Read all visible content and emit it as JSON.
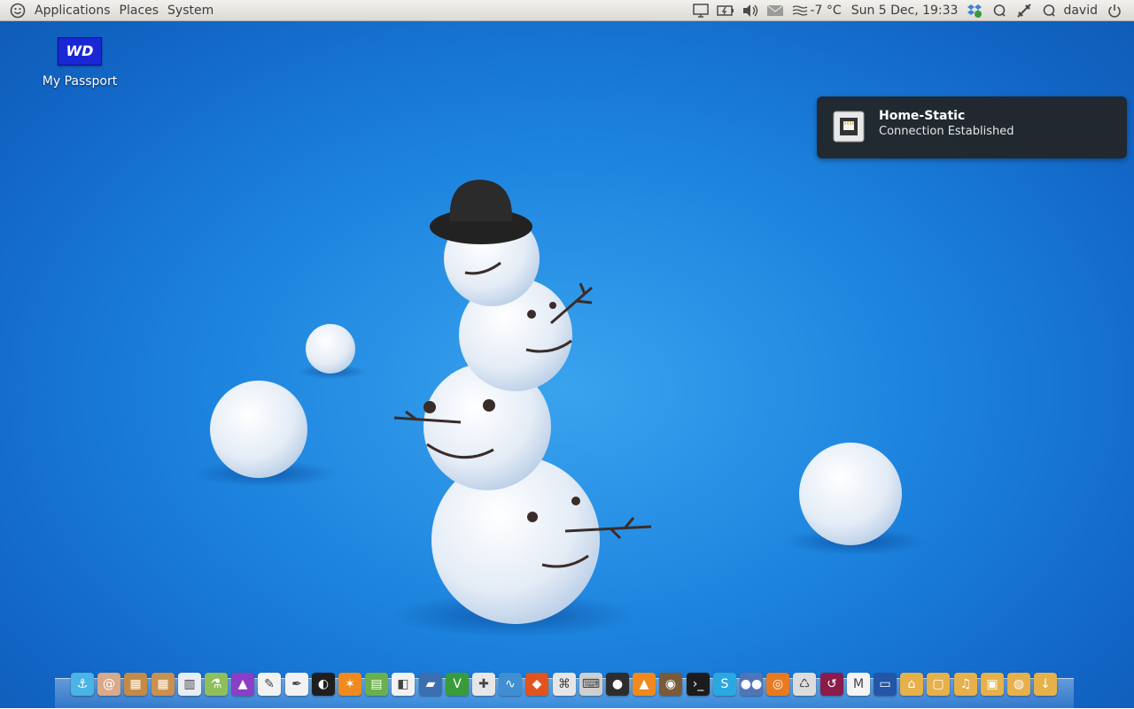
{
  "panel": {
    "menus": [
      "Applications",
      "Places",
      "System"
    ],
    "weather": "-7 °C",
    "clock": "Sun  5 Dec, 19:33",
    "user": "david"
  },
  "desktop": {
    "drive_logo": "WD",
    "drive_label": "My Passport"
  },
  "notification": {
    "title": "Home-Static",
    "body": "Connection Established"
  },
  "dock": {
    "items": [
      {
        "icon": "anchor-icon",
        "color": "#49b4e6",
        "glyph": "⚓"
      },
      {
        "icon": "shell-icon",
        "color": "#d9a98a",
        "glyph": "@"
      },
      {
        "icon": "package-icon",
        "color": "#c48a47",
        "glyph": "▦"
      },
      {
        "icon": "package-installer-icon",
        "color": "#c9904e",
        "glyph": "▦"
      },
      {
        "icon": "system-monitor-icon",
        "color": "#e8ecf5",
        "glyph": "▥"
      },
      {
        "icon": "chemistry-icon",
        "color": "#8fbf5a",
        "glyph": "⚗"
      },
      {
        "icon": "hat-icon",
        "color": "#8b3fc7",
        "glyph": "▲"
      },
      {
        "icon": "vector-draw-icon",
        "color": "#f2f2f2",
        "glyph": "✎"
      },
      {
        "icon": "pen-tool-icon",
        "color": "#f2f2f2",
        "glyph": "✒"
      },
      {
        "icon": "camera-raw-icon",
        "color": "#1e1e1e",
        "glyph": "◐"
      },
      {
        "icon": "figure-icon",
        "color": "#f08a1e",
        "glyph": "✶"
      },
      {
        "icon": "spreadsheet-icon",
        "color": "#6ab04c",
        "glyph": "▤"
      },
      {
        "icon": "presentation-icon",
        "color": "#f2f2f2",
        "glyph": "◧"
      },
      {
        "icon": "chart-app-icon",
        "color": "#3c6fb2",
        "glyph": "▰"
      },
      {
        "icon": "vim-icon",
        "color": "#3a9b3a",
        "glyph": "V"
      },
      {
        "icon": "lifebuoy-icon",
        "color": "#e7e7e7",
        "glyph": "✚"
      },
      {
        "icon": "waveform-icon",
        "color": "#3f8fd2",
        "glyph": "∿"
      },
      {
        "icon": "cube-icon",
        "color": "#e2531e",
        "glyph": "◆"
      },
      {
        "icon": "inkscape-icon",
        "color": "#e6e6e6",
        "glyph": "⌘"
      },
      {
        "icon": "keyboard-icon",
        "color": "#cfcfcf",
        "glyph": "⌨"
      },
      {
        "icon": "webcam-icon",
        "color": "#2d2d2d",
        "glyph": "●"
      },
      {
        "icon": "vlc-icon",
        "color": "#f08a1e",
        "glyph": "▲"
      },
      {
        "icon": "speaker-icon",
        "color": "#7a5a3a",
        "glyph": "◉"
      },
      {
        "icon": "terminal-icon",
        "color": "#1c1c1c",
        "glyph": "›_"
      },
      {
        "icon": "skype-icon",
        "color": "#2aa9e0",
        "glyph": "S"
      },
      {
        "icon": "pidgin-icon",
        "color": "#4f75b8",
        "glyph": "●●"
      },
      {
        "icon": "firefox-icon",
        "color": "#e97a1f",
        "glyph": "◎"
      },
      {
        "icon": "trash-icon",
        "color": "#dcdcdc",
        "glyph": "♺"
      },
      {
        "icon": "backup-icon",
        "color": "#8a1c4a",
        "glyph": "↺"
      },
      {
        "icon": "gmail-icon",
        "color": "#f4f4f4",
        "glyph": "M"
      },
      {
        "icon": "display-icon",
        "color": "#2456a8",
        "glyph": "▭"
      },
      {
        "icon": "home-folder-icon",
        "color": "#e6b04a",
        "glyph": "⌂"
      },
      {
        "icon": "documents-folder-icon",
        "color": "#e6b04a",
        "glyph": "▢"
      },
      {
        "icon": "music-folder-icon",
        "color": "#e6b04a",
        "glyph": "♫"
      },
      {
        "icon": "pictures-folder-icon",
        "color": "#e6b04a",
        "glyph": "▣"
      },
      {
        "icon": "videos-folder-icon",
        "color": "#e6b04a",
        "glyph": "◍"
      },
      {
        "icon": "downloads-folder-icon",
        "color": "#e6b04a",
        "glyph": "↓"
      }
    ]
  }
}
